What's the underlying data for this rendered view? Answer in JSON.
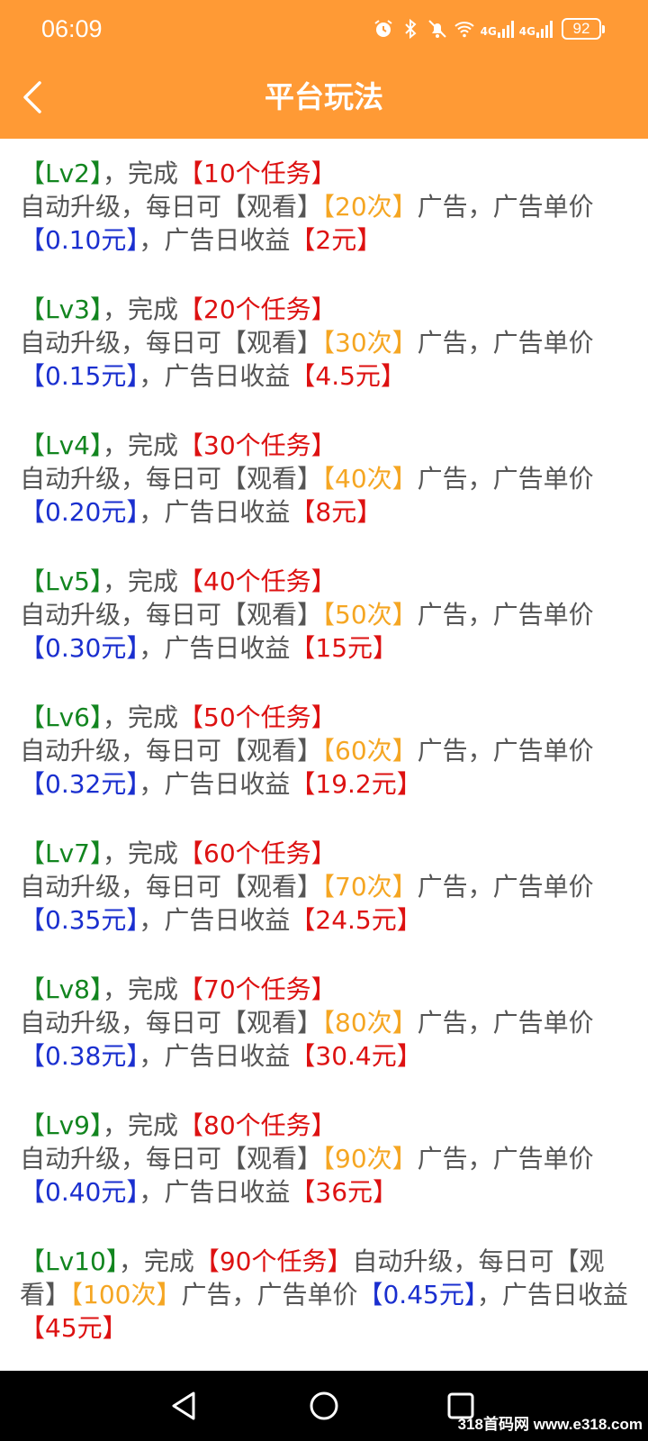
{
  "status_bar": {
    "time": "06:09",
    "network_label_1": "4G",
    "network_label_2": "4G",
    "battery": "92"
  },
  "header": {
    "title": "平台玩法",
    "back_icon": "chevron-left-icon"
  },
  "levels": [
    {
      "segments": [
        {
          "t": "【Lv2】",
          "c": "green"
        },
        {
          "t": "，完成",
          "c": "gray"
        },
        {
          "t": "【10个任务】",
          "c": "red"
        },
        {
          "t": "自动升级，每日可【观看】",
          "c": "gray"
        },
        {
          "t": "【20次】",
          "c": "orange"
        },
        {
          "t": "广告，广告单价",
          "c": "gray"
        },
        {
          "t": "【0.10元】",
          "c": "blue"
        },
        {
          "t": "，广告日收益",
          "c": "gray"
        },
        {
          "t": "【2元】",
          "c": "red"
        }
      ]
    },
    {
      "segments": [
        {
          "t": "【Lv3】",
          "c": "green"
        },
        {
          "t": "，完成",
          "c": "gray"
        },
        {
          "t": "【20个任务】",
          "c": "red"
        },
        {
          "t": "自动升级，每日可【观看】",
          "c": "gray"
        },
        {
          "t": "【30次】",
          "c": "orange"
        },
        {
          "t": "广告，广告单价",
          "c": "gray"
        },
        {
          "t": "【0.15元】",
          "c": "blue"
        },
        {
          "t": "，广告日收益",
          "c": "gray"
        },
        {
          "t": "【4.5元】",
          "c": "red"
        }
      ]
    },
    {
      "segments": [
        {
          "t": "【Lv4】",
          "c": "green"
        },
        {
          "t": "，完成",
          "c": "gray"
        },
        {
          "t": "【30个任务】",
          "c": "red"
        },
        {
          "t": "自动升级，每日可【观看】",
          "c": "gray"
        },
        {
          "t": "【40次】",
          "c": "orange"
        },
        {
          "t": "广告，广告单价",
          "c": "gray"
        },
        {
          "t": "【0.20元】",
          "c": "blue"
        },
        {
          "t": "，广告日收益",
          "c": "gray"
        },
        {
          "t": "【8元】",
          "c": "red"
        }
      ]
    },
    {
      "segments": [
        {
          "t": "【Lv5】",
          "c": "green"
        },
        {
          "t": "，完成",
          "c": "gray"
        },
        {
          "t": "【40个任务】",
          "c": "red"
        },
        {
          "t": "自动升级，每日可【观看】",
          "c": "gray"
        },
        {
          "t": "【50次】",
          "c": "orange"
        },
        {
          "t": "广告，广告单价",
          "c": "gray"
        },
        {
          "t": "【0.30元】",
          "c": "blue"
        },
        {
          "t": "，广告日收益",
          "c": "gray"
        },
        {
          "t": "【15元】",
          "c": "red"
        }
      ]
    },
    {
      "segments": [
        {
          "t": "【Lv6】",
          "c": "green"
        },
        {
          "t": "，完成",
          "c": "gray"
        },
        {
          "t": "【50个任务】",
          "c": "red"
        },
        {
          "t": "自动升级，每日可【观看】",
          "c": "gray"
        },
        {
          "t": "【60次】",
          "c": "orange"
        },
        {
          "t": "广告，广告单价",
          "c": "gray"
        },
        {
          "t": "【0.32元】",
          "c": "blue"
        },
        {
          "t": "，广告日收益",
          "c": "gray"
        },
        {
          "t": "【19.2元】",
          "c": "red"
        }
      ]
    },
    {
      "segments": [
        {
          "t": "【Lv7】",
          "c": "green"
        },
        {
          "t": "，完成",
          "c": "gray"
        },
        {
          "t": "【60个任务】",
          "c": "red"
        },
        {
          "t": "自动升级，每日可【观看】",
          "c": "gray"
        },
        {
          "t": "【70次】",
          "c": "orange"
        },
        {
          "t": "广告，广告单价",
          "c": "gray"
        },
        {
          "t": "【0.35元】",
          "c": "blue"
        },
        {
          "t": "，广告日收益",
          "c": "gray"
        },
        {
          "t": "【24.5元】",
          "c": "red"
        }
      ]
    },
    {
      "segments": [
        {
          "t": "【Lv8】",
          "c": "green"
        },
        {
          "t": "，完成",
          "c": "gray"
        },
        {
          "t": "【70个任务】",
          "c": "red"
        },
        {
          "t": "自动升级，每日可【观看】",
          "c": "gray"
        },
        {
          "t": "【80次】",
          "c": "orange"
        },
        {
          "t": "广告，广告单价",
          "c": "gray"
        },
        {
          "t": "【0.38元】",
          "c": "blue"
        },
        {
          "t": "，广告日收益",
          "c": "gray"
        },
        {
          "t": "【30.4元】",
          "c": "red"
        }
      ]
    },
    {
      "segments": [
        {
          "t": "【Lv9】",
          "c": "green"
        },
        {
          "t": "，完成",
          "c": "gray"
        },
        {
          "t": "【80个任务】",
          "c": "red"
        },
        {
          "t": "自动升级，每日可【观看】",
          "c": "gray"
        },
        {
          "t": "【90次】",
          "c": "orange"
        },
        {
          "t": "广告，广告单价",
          "c": "gray"
        },
        {
          "t": "【0.40元】",
          "c": "blue"
        },
        {
          "t": "，广告日收益",
          "c": "gray"
        },
        {
          "t": "【36元】",
          "c": "red"
        }
      ]
    },
    {
      "segments": [
        {
          "t": "【Lv10】",
          "c": "green"
        },
        {
          "t": "，完成",
          "c": "gray"
        },
        {
          "t": "【90个任务】",
          "c": "red"
        },
        {
          "t": "自动升级，每日可【观看】",
          "c": "gray"
        },
        {
          "t": "【100次】",
          "c": "orange"
        },
        {
          "t": "广告，广告单价",
          "c": "gray"
        },
        {
          "t": "【0.45元】",
          "c": "blue"
        },
        {
          "t": "，广告日收益",
          "c": "gray"
        },
        {
          "t": "【45元】",
          "c": "red"
        }
      ]
    }
  ],
  "nav_bar": {
    "back_icon": "triangle-back-icon",
    "home_icon": "circle-home-icon",
    "recents_icon": "square-recents-icon"
  },
  "watermark": "318首码网 www.e318.com",
  "colors": {
    "header_bg": "#ff9a35",
    "green": "#12851f",
    "red": "#dd1111",
    "orange": "#f5a623",
    "blue": "#1a2fcf",
    "gray": "#555555"
  }
}
